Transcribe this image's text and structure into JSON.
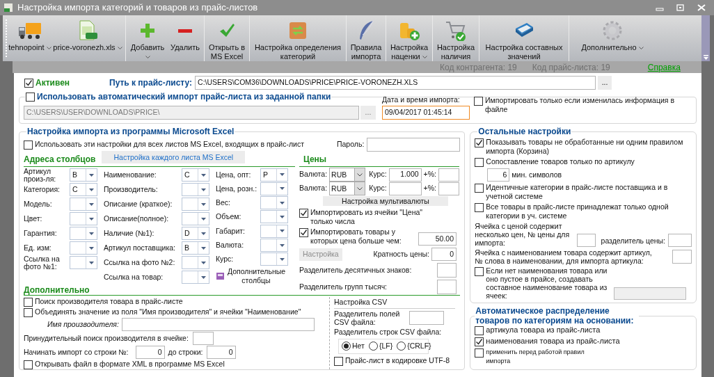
{
  "window": {
    "title": "Настройка импорта категорий и товаров из прайс-листов"
  },
  "toolbar": [
    [
      {
        "label": "tehnopoint",
        "dropdown": true
      },
      {
        "label": "price-voronezh.xls",
        "dropdown": true
      }
    ],
    [
      {
        "label": "Добавить",
        "dropdown": true
      },
      {
        "label": "Удалить",
        "dropdown": false
      }
    ],
    [
      {
        "label": "Открыть в MS Excel",
        "dropdown": false
      }
    ],
    [
      {
        "label": "Настройка определения категорий",
        "dropdown": false
      }
    ],
    [
      {
        "label": "Правила импорта",
        "dropdown": false
      }
    ],
    [
      {
        "label": "Настройка наценки",
        "dropdown": true
      }
    ],
    [
      {
        "label": "Настройка наличия",
        "dropdown": false
      }
    ],
    [
      {
        "label": "Настройка составных значений",
        "dropdown": false
      }
    ],
    [
      {
        "label": "Дополнительно",
        "dropdown": true
      }
    ]
  ],
  "info": {
    "contractor_code": "Код контрагента: 19",
    "pricelist_code": "Код прайс-листа: 19",
    "help_link": "Справка"
  },
  "active": {
    "label": "Активен",
    "checked": true
  },
  "price_path": {
    "label": "Путь к прайс-листу:",
    "value": "C:\\USERS\\COM36\\DOWNLOADS\\PRICE\\PRICE-VORONEZH.XLS",
    "browse": "..."
  },
  "auto_import": {
    "label": "Использовать автоматический импорт прайс-листа из заданной папки",
    "checked": false,
    "folder": "C:\\USERS\\USER\\DOWNLOADS\\PRICE\\",
    "browse": "...",
    "date_label": "Дата и время импорта:",
    "date_value": "09/04/2017 01:45:14",
    "only_if_changed": {
      "label": "Импортировать только если изменилась информация в файле",
      "checked": false
    }
  },
  "excel": {
    "title": "Настройка импорта из программы Microsoft Excel",
    "all_sheets": {
      "label": "Использовать эти настройки для всех листов MS Excel, входящих в прайс-лист",
      "checked": false
    },
    "password_label": "Пароль:",
    "sheet_button": "Настройка каждого листа MS Excel",
    "columns_title": "Адреса столбцов",
    "columns": [
      [
        {
          "label": "Артикул произ-ля:",
          "value": "B"
        },
        {
          "label": "Категория:",
          "value": "C"
        },
        {
          "label": "Модель:"
        },
        {
          "label": "Цвет:"
        },
        {
          "label": "Гарантия:"
        },
        {
          "label": "Ед. изм:"
        },
        {
          "label": "Ссылка на фото №1:"
        }
      ],
      [
        {
          "label": "Наименование:",
          "value": "C"
        },
        {
          "label": "Производитель:"
        },
        {
          "label": "Описание (краткое):"
        },
        {
          "label": "Описание(полное):"
        },
        {
          "label": "Наличие (№1):",
          "value": "D"
        },
        {
          "label": "Артикул поставщика:",
          "value": "B"
        },
        {
          "label": "Ссылка на фото №2:"
        },
        {
          "label": "Ссылка на товар:"
        }
      ],
      [
        {
          "label": "Цена, опт:",
          "value": "P"
        },
        {
          "label": "Цена, розн.:"
        },
        {
          "label": "Вес:"
        },
        {
          "label": "Объем:"
        },
        {
          "label": "Габарит:"
        },
        {
          "label": "Валюта:"
        },
        {
          "label": "Курс:"
        }
      ]
    ],
    "extra_columns_button": "Дополнительные столбцы",
    "prices_title": "Цены",
    "currencies": [
      {
        "label": "Валюта:",
        "currency": "RUB",
        "rate_label": "Курс:",
        "rate": "1.000",
        "percent_label": "+%:"
      },
      {
        "label": "Валюта:",
        "currency": "RUB",
        "rate_label": "Курс:",
        "percent_label": "+%:"
      }
    ],
    "multicurrency_button": "Настройка мультивалюты",
    "numbers_only": {
      "label": "Импортировать из ячейки \"Цена\" только числа",
      "checked": true
    },
    "min_price": {
      "label": "Импортировать товары у которых цена больше чем:",
      "checked": true,
      "value": "50.00"
    },
    "settings_button": {
      "label": "Настройка",
      "disabled": true
    },
    "price_multiple": {
      "label": "Кратность цены:",
      "value": "0"
    },
    "decimal_separator_label": "Разделитель десятичных знаков:",
    "thousands_separator_label": "Разделитель групп тысяч:",
    "additional_title": "Дополнительно",
    "find_manufacturer": {
      "label": "Поиск производителя товара в прайс-листе",
      "checked": false
    },
    "merge_manufacturer": {
      "label": "Объединять значение из поля \"Имя производителя\" и ячейки \"Наименование\"",
      "checked": false
    },
    "manufacturer_name_label": "Имя производителя:",
    "forced_search_label": "Принудительный поиск производителя в ячейке:",
    "start_row_label": "Начинать импорт со строки №:",
    "start_row": "0",
    "end_row_label": "до строки:",
    "end_row": "0",
    "open_xml": {
      "label": "Открывать файл в формате XML в программе MS Excel",
      "checked": false
    },
    "csv": {
      "title": "Настройка CSV",
      "field_separator_label": "Разделитель полей CSV файла:",
      "row_separator_label": "Разделитель строк CSV файла:",
      "row_separators": [
        {
          "label": "Нет",
          "selected": true
        },
        {
          "label": "{LF}",
          "selected": false
        },
        {
          "label": "{CRLF}",
          "selected": false
        }
      ],
      "utf8": {
        "label": "Прайс-лист в кодировке UTF-8",
        "checked": false
      }
    }
  },
  "other": {
    "title": "Остальные настройки",
    "show_basket": {
      "label": "Показывать товары не обработанные ни одним правилом импорта (Корзина)",
      "checked": true
    },
    "match_by_article": {
      "label": "Сопоставление товаров только по артикулу",
      "checked": false,
      "min_chars": "6",
      "min_chars_label": "мин. символов"
    },
    "identical_categories": {
      "label": "Идентичные категории в прайс-листе поставщика и в учетной системе",
      "checked": false
    },
    "single_category": {
      "label": "Все товары в прайс-листе принадлежат только одной категории в уч. системе",
      "checked": false
    },
    "multi_price": {
      "label": "Ячейка с ценой содержит несколько цен, № цены для импорта:",
      "separator_label": "разделитель цены:"
    },
    "article_in_name": {
      "label": "Ячейка с наименованием товара содержит артикул, № слова в наименовании, для импорта артикула:"
    },
    "compose_name": {
      "label": "Если нет наименования товара или оно пустое в прайсе, создавать составное наименование товара из ячеек:",
      "checked": false
    }
  },
  "auto_distribution": {
    "title": "Автоматическое распределение товаров по категориям на основании:",
    "options": [
      {
        "kind": "basis",
        "label": "артикула товара из прайс-листа",
        "checked": false
      },
      {
        "kind": "basis",
        "label": "наименования товара из прайс-листа",
        "checked": true
      },
      {
        "kind": "note",
        "label": "применить перед работой правил импорта",
        "checked": false
      }
    ]
  }
}
